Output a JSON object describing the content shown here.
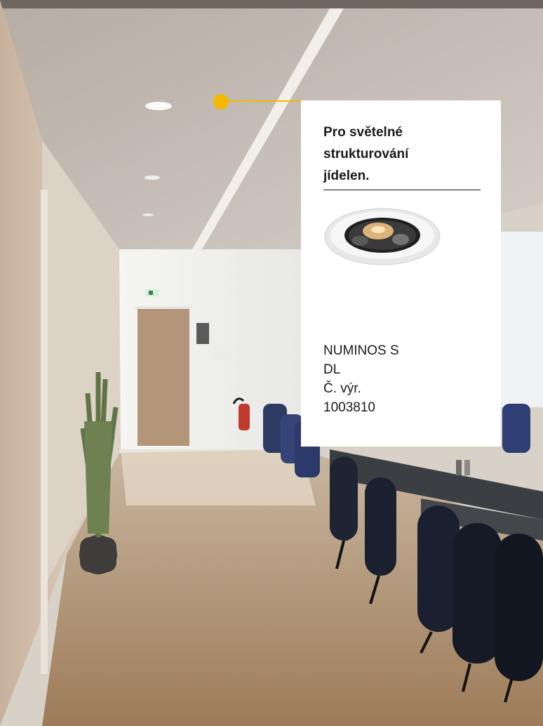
{
  "callout": {
    "accent_color": "#f5b800",
    "headline_lines": [
      "Pro světelné",
      "strukturování",
      "jídelen."
    ],
    "product": {
      "name_lines": [
        "NUMINOS S",
        "DL"
      ],
      "article_number": "Č. výr.",
      "article_value": "1003810"
    }
  }
}
